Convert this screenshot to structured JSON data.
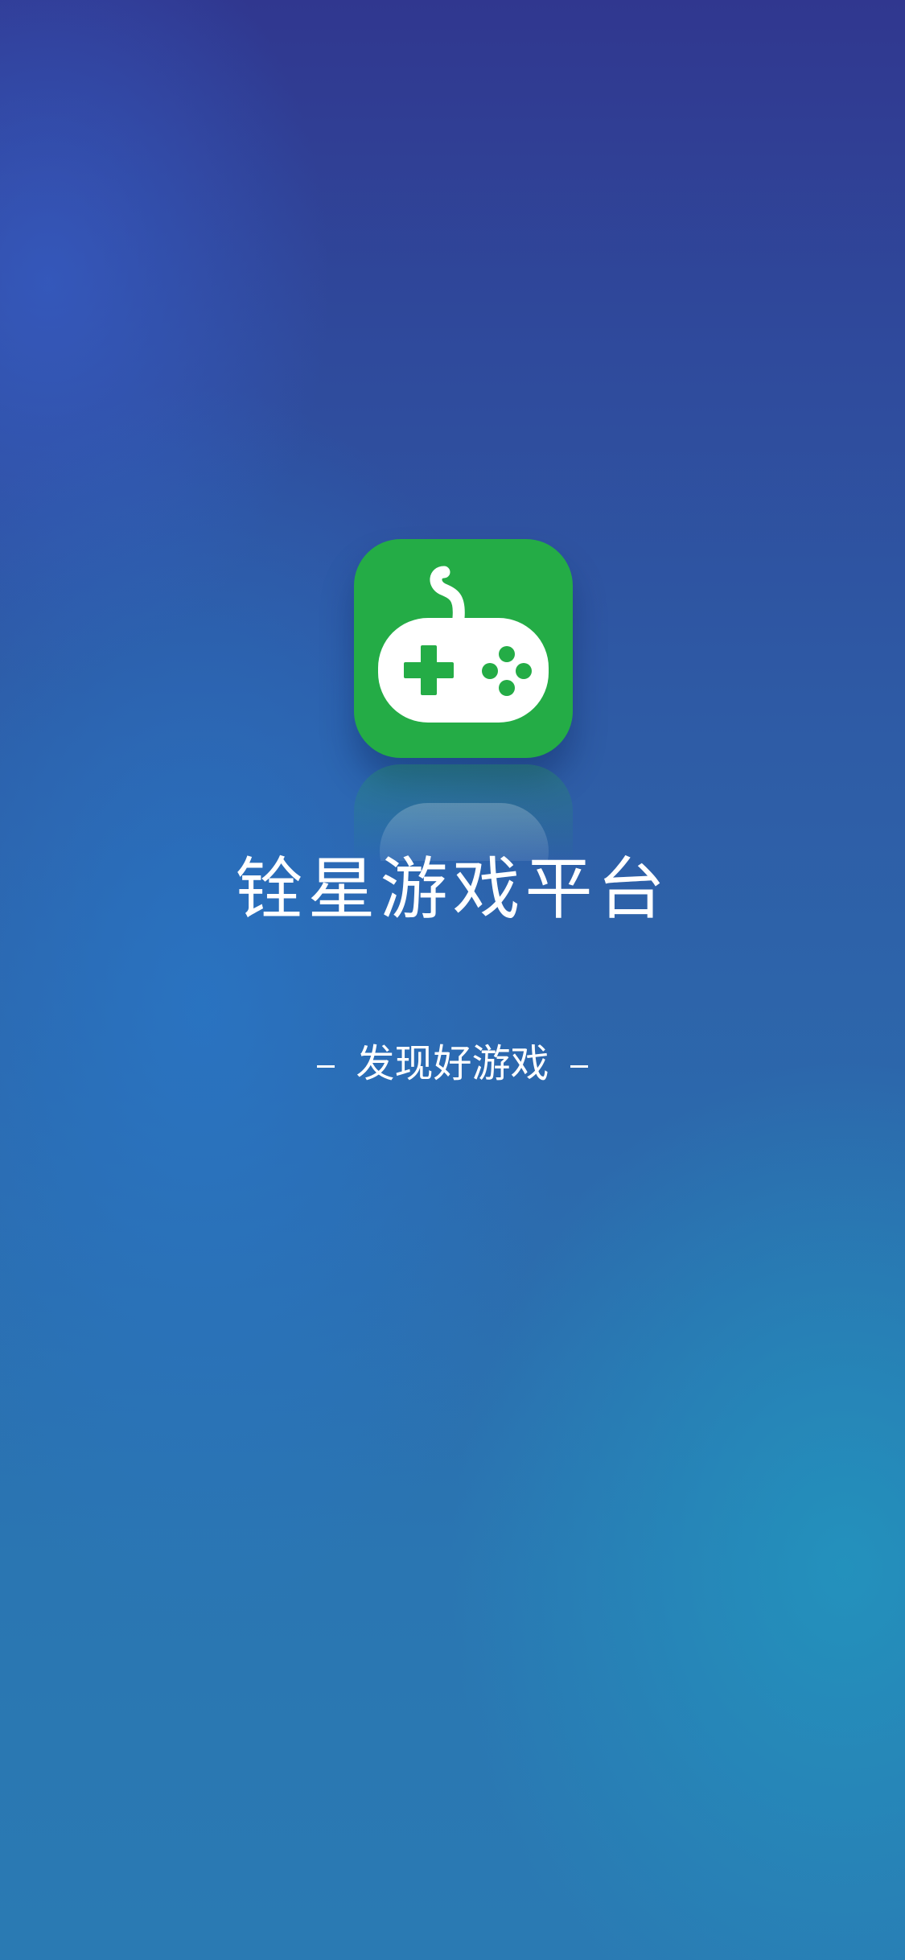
{
  "splash": {
    "app_name": "铨星游戏平台",
    "slogan": "发现好游戏",
    "icon": "gamepad-icon"
  },
  "colors": {
    "icon_background": "#24ac46",
    "text": "#ffffff",
    "background_top": "#30378f",
    "background_bottom": "#2a7ab3"
  }
}
